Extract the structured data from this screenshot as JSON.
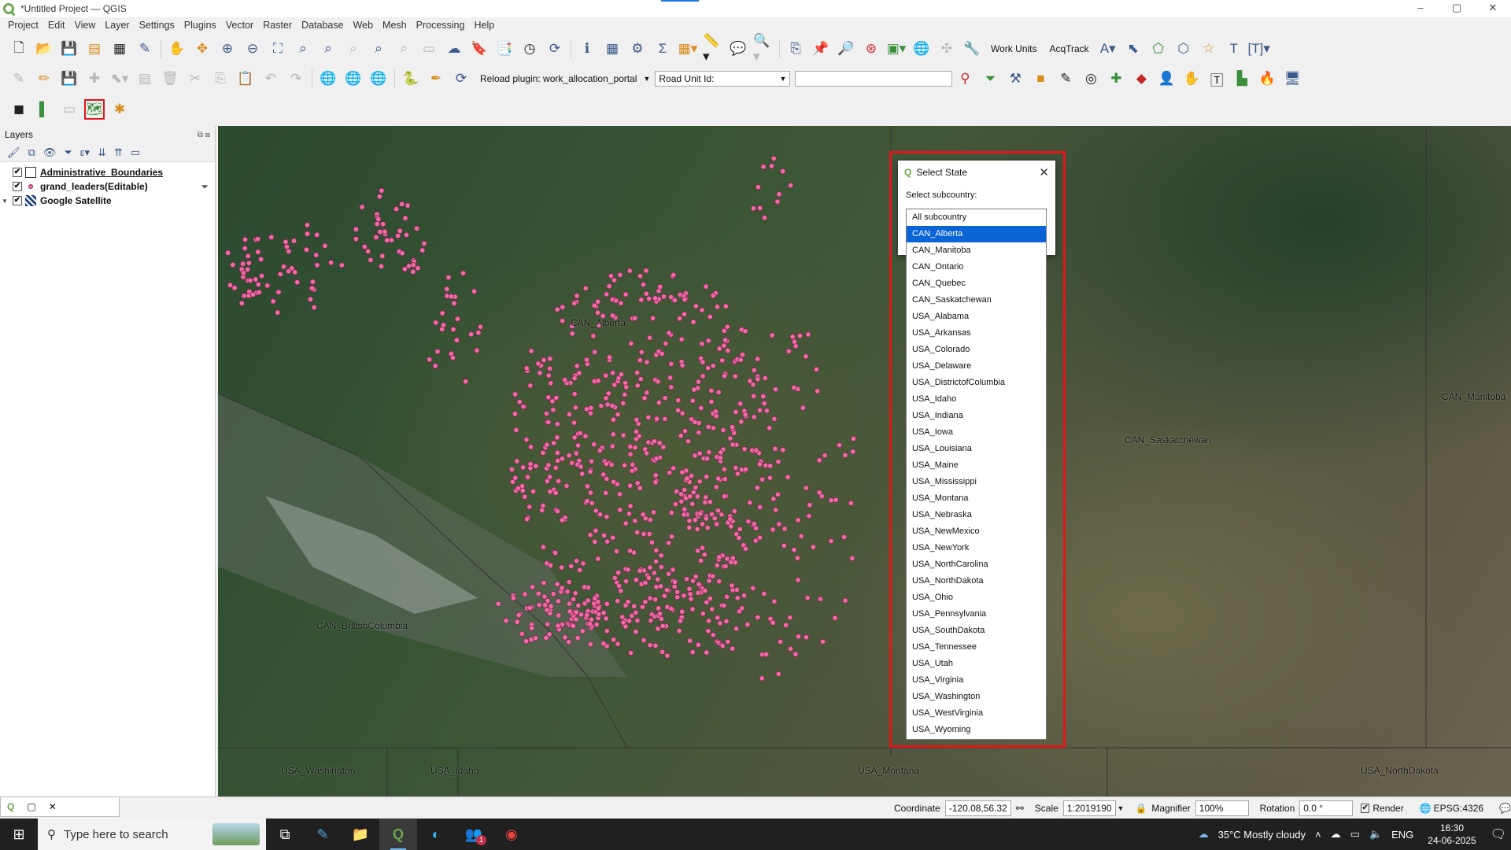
{
  "window": {
    "title": "*Untitled Project — QGIS",
    "controls": [
      "–",
      "▢",
      "✕"
    ]
  },
  "menu": [
    "Project",
    "Edit",
    "View",
    "Layer",
    "Settings",
    "Plugins",
    "Vector",
    "Raster",
    "Database",
    "Web",
    "Mesh",
    "Processing",
    "Help"
  ],
  "toolbar": {
    "work_units": "Work Units",
    "acqtrack": "AcqTrack",
    "reload_plugin_label": "Reload plugin: work_allocation_portal",
    "road_unit_label": "Road Unit Id:",
    "road_unit_value": ""
  },
  "layers_panel": {
    "title": "Layers",
    "layers": [
      {
        "name": "Administrative_Boundaries",
        "checked": true,
        "icon": "polygon-layer-icon"
      },
      {
        "name": "grand_leaders(Editable)",
        "checked": true,
        "icon": "point-layer-icon"
      },
      {
        "name": "Google Satellite",
        "checked": true,
        "icon": "raster-layer-icon"
      }
    ]
  },
  "map": {
    "labels": {
      "can_alberta": "CAN_Alberta",
      "can_saskatchewan": "CAN_Saskatchewan",
      "can_manitoba": "CAN_Manitoba",
      "can_british_columbia": "CAN_BritishColumbia",
      "usa_washington": "USA_Washington",
      "usa_idaho": "USA_Idaho",
      "usa_montana": "USA_Montana",
      "usa_northdakota": "USA_NorthDakota"
    },
    "point_color": "#f06aa3"
  },
  "dialog": {
    "title": "Select State",
    "label": "Select subcountry:",
    "selected": "CAN_Alberta",
    "options": [
      "All subcountry",
      "CAN_Alberta",
      "CAN_Manitoba",
      "CAN_Ontario",
      "CAN_Quebec",
      "CAN_Saskatchewan",
      "USA_Alabama",
      "USA_Arkansas",
      "USA_Colorado",
      "USA_Delaware",
      "USA_DistrictofColumbia",
      "USA_Idaho",
      "USA_Indiana",
      "USA_Iowa",
      "USA_Louisiana",
      "USA_Maine",
      "USA_Mississippi",
      "USA_Montana",
      "USA_Nebraska",
      "USA_NewMexico",
      "USA_NewYork",
      "USA_NorthCarolina",
      "USA_NorthDakota",
      "USA_Ohio",
      "USA_Pennsylvania",
      "USA_SouthDakota",
      "USA_Tennessee",
      "USA_Utah",
      "USA_Virginia",
      "USA_Washington",
      "USA_WestVirginia",
      "USA_Wyoming"
    ]
  },
  "statusbar": {
    "coordinate_label": "Coordinate",
    "coordinate_value": "-120.08,56.32",
    "scale_label": "Scale",
    "scale_value": "1:2019190",
    "magnifier_label": "Magnifier",
    "magnifier_value": "100%",
    "rotation_label": "Rotation",
    "rotation_value": "0.0 °",
    "render_label": "Render",
    "crs": "EPSG:4326"
  },
  "taskbar": {
    "search_placeholder": "Type here to search",
    "weather": "35°C  Mostly cloudy",
    "language": "ENG",
    "time": "16:30",
    "date": "24-06-2025",
    "teams_badge": "1"
  },
  "colors": {
    "highlight_red": "#e0161b",
    "selection_blue": "#0a64d6",
    "qgis_green": "#6aa84f"
  }
}
